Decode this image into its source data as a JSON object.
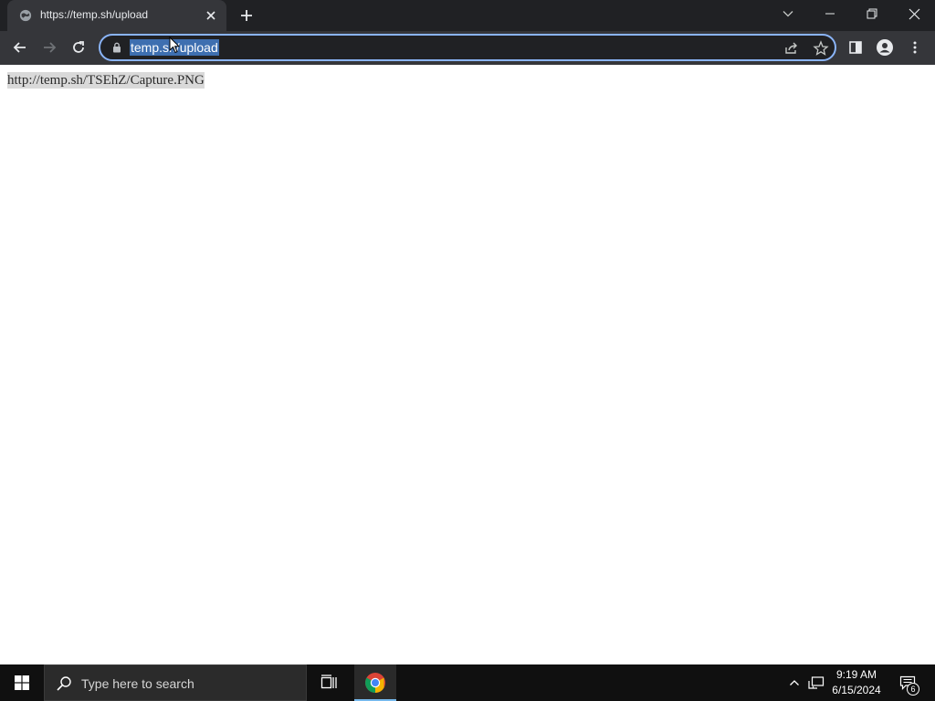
{
  "browser": {
    "tab": {
      "title": "https://temp.sh/upload"
    },
    "omnibox": {
      "url": "temp.sh/upload"
    }
  },
  "page": {
    "content_text": "http://temp.sh/TSEhZ/Capture.PNG"
  },
  "taskbar": {
    "search_placeholder": "Type here to search",
    "clock": {
      "time": "9:19 AM",
      "date": "6/15/2024"
    },
    "notification_count": "6"
  },
  "colors": {
    "tabstrip_bg": "#202124",
    "toolbar_bg": "#35363a",
    "omnibox_focus_border": "#8ab4f8",
    "url_selection": "#3e6fb0",
    "taskbar_bg": "#101010",
    "taskbar_active_underline": "#76b9ed"
  },
  "icons": {
    "tab_favicon": "globe-icon",
    "tab_close": "close-icon",
    "new_tab": "plus-icon",
    "tab_search": "chevron-down-icon",
    "minimize": "minimize-icon",
    "restore": "restore-icon",
    "close_window": "close-icon",
    "back": "back-arrow-icon",
    "forward": "forward-arrow-icon",
    "reload": "reload-icon",
    "lock": "lock-icon",
    "share": "share-icon",
    "bookmark": "star-icon",
    "side_panel": "side-panel-icon",
    "profile": "profile-icon",
    "menu": "kebab-menu-icon",
    "start": "windows-logo-icon",
    "search": "search-icon",
    "task_view": "task-view-icon",
    "chrome": "chrome-icon",
    "tray_chevron": "chevron-up-icon",
    "network": "network-icon",
    "notifications": "notification-icon"
  }
}
